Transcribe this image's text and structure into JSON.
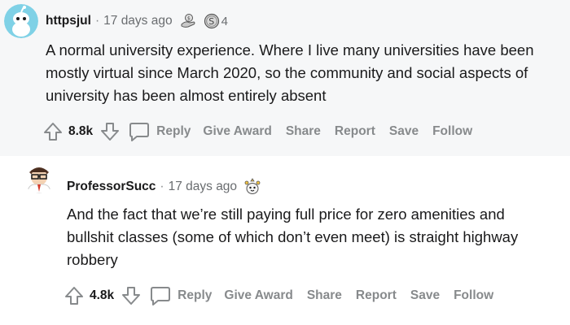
{
  "comments": [
    {
      "author": "httpsjul",
      "separator": "·",
      "time": "17 days ago",
      "award_icon_1": "moneybag-hand-award-icon",
      "award_icon_2": "silver-coin-award-icon",
      "award_count": "4",
      "text": "A normal university experience. Where I live many universities have been mostly virtual since March 2020, so the community and social aspects of university has been almost entirely absent",
      "score": "8.8k",
      "actions": {
        "reply": "Reply",
        "give_award": "Give Award",
        "share": "Share",
        "report": "Report",
        "save": "Save",
        "follow": "Follow"
      }
    },
    {
      "author": "ProfessorSucc",
      "separator": "·",
      "time": "17 days ago",
      "award_icon_1": "wholesome-seal-award-icon",
      "text": "And the fact that we’re still paying full price for zero amenities and bullshit classes (some of which don’t even meet) is straight highway robbery",
      "score": "4.8k",
      "actions": {
        "reply": "Reply",
        "give_award": "Give Award",
        "share": "Share",
        "report": "Report",
        "save": "Save",
        "follow": "Follow"
      }
    }
  ],
  "colors": {
    "thread_bg": "#f6f7f8",
    "muted": "#878a8c",
    "text": "#1a1a1b",
    "avatar_blue": "#7fd1e6"
  }
}
